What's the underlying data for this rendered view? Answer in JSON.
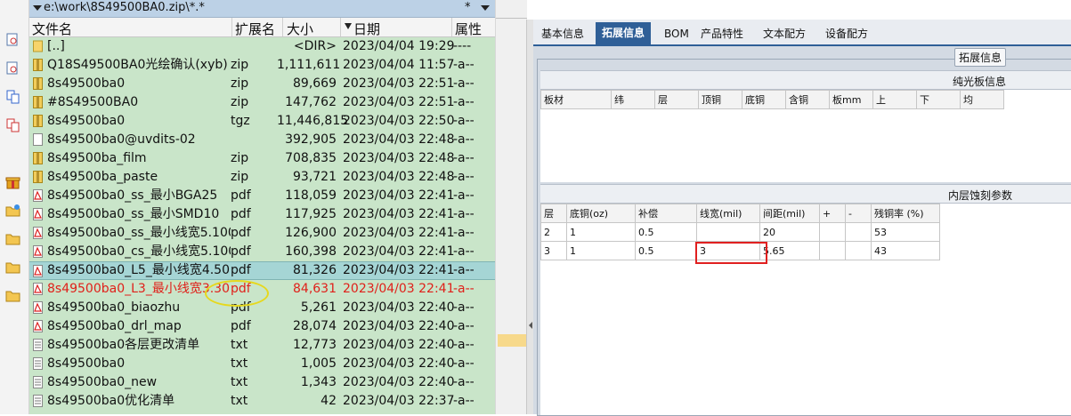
{
  "file_panel": {
    "path": "e:\\work\\8S49500BA0.zip\\*.*",
    "filter": "*",
    "columns": {
      "name": "文件名",
      "ext": "扩展名",
      "size": "大小",
      "date": "日期",
      "attr": "属性"
    },
    "files": [
      {
        "name": "[..]",
        "ext": "",
        "size": "<DIR>",
        "date": "2023/04/04 19:29",
        "attr": "----",
        "icon": "parent-folder-icon"
      },
      {
        "name": "Q18S49500BA0光绘确认(xyb)",
        "ext": "zip",
        "size": "1,111,611",
        "date": "2023/04/04 11:57",
        "attr": "-a--",
        "icon": "zip-icon"
      },
      {
        "name": "8s49500ba0",
        "ext": "zip",
        "size": "89,669",
        "date": "2023/04/03 22:51",
        "attr": "-a--",
        "icon": "zip-icon"
      },
      {
        "name": "#8S49500BA0",
        "ext": "zip",
        "size": "147,762",
        "date": "2023/04/03 22:51",
        "attr": "-a--",
        "icon": "zip-icon"
      },
      {
        "name": "8s49500ba0",
        "ext": "tgz",
        "size": "11,446,815",
        "date": "2023/04/03 22:50",
        "attr": "-a--",
        "icon": "zip-icon"
      },
      {
        "name": "8s49500ba0@uvdits-02",
        "ext": "",
        "size": "392,905",
        "date": "2023/04/03 22:48",
        "attr": "-a--",
        "icon": "file-icon"
      },
      {
        "name": "8s49500ba_film",
        "ext": "zip",
        "size": "708,835",
        "date": "2023/04/03 22:48",
        "attr": "-a--",
        "icon": "zip-icon"
      },
      {
        "name": "8s49500ba_paste",
        "ext": "zip",
        "size": "93,721",
        "date": "2023/04/03 22:48",
        "attr": "-a--",
        "icon": "zip-icon"
      },
      {
        "name": "8s49500ba0_ss_最小BGA25",
        "ext": "pdf",
        "size": "118,059",
        "date": "2023/04/03 22:41",
        "attr": "-a--",
        "icon": "pdf-icon"
      },
      {
        "name": "8s49500ba0_ss_最小SMD10",
        "ext": "pdf",
        "size": "117,925",
        "date": "2023/04/03 22:41",
        "attr": "-a--",
        "icon": "pdf-icon"
      },
      {
        "name": "8s49500ba0_ss_最小线宽5.100",
        "ext": "pdf",
        "size": "126,900",
        "date": "2023/04/03 22:41",
        "attr": "-a--",
        "icon": "pdf-icon"
      },
      {
        "name": "8s49500ba0_cs_最小线宽5.100",
        "ext": "pdf",
        "size": "160,398",
        "date": "2023/04/03 22:41",
        "attr": "-a--",
        "icon": "pdf-icon"
      },
      {
        "name": "8s49500ba0_L5_最小线宽4.50",
        "ext": "pdf",
        "size": "81,326",
        "date": "2023/04/03 22:41",
        "attr": "-a--",
        "icon": "pdf-icon",
        "selected": true
      },
      {
        "name": "8s49500ba0_L3_最小线宽3.30..",
        "ext": "pdf",
        "size": "84,631",
        "date": "2023/04/03 22:41",
        "attr": "-a--",
        "icon": "pdf-icon",
        "red": true
      },
      {
        "name": "8s49500ba0_biaozhu",
        "ext": "pdf",
        "size": "5,261",
        "date": "2023/04/03 22:40",
        "attr": "-a--",
        "icon": "pdf-icon"
      },
      {
        "name": "8s49500ba0_drl_map",
        "ext": "pdf",
        "size": "28,074",
        "date": "2023/04/03 22:40",
        "attr": "-a--",
        "icon": "pdf-icon"
      },
      {
        "name": "8s49500ba0各层更改清单",
        "ext": "txt",
        "size": "12,773",
        "date": "2023/04/03 22:40",
        "attr": "-a--",
        "icon": "txt-icon"
      },
      {
        "name": "8s49500ba0",
        "ext": "txt",
        "size": "1,005",
        "date": "2023/04/03 22:40",
        "attr": "-a--",
        "icon": "txt-icon"
      },
      {
        "name": "8s49500ba0_new",
        "ext": "txt",
        "size": "1,343",
        "date": "2023/04/03 22:40",
        "attr": "-a--",
        "icon": "txt-icon"
      },
      {
        "name": "8s49500ba0优化清单",
        "ext": "txt",
        "size": "42",
        "date": "2023/04/03 22:37",
        "attr": "-a--",
        "icon": "txt-icon"
      }
    ]
  },
  "tabs": [
    "基本信息",
    "拓展信息",
    "BOM",
    "产品特性",
    "文本配方",
    "设备配方"
  ],
  "active_tab": "拓展信息",
  "group_label": "拓展信息",
  "section1": {
    "title": "纯光板信息",
    "headers": [
      "板材",
      "纬",
      "层",
      "顶铜",
      "底铜",
      "含铜",
      "板mm",
      "上",
      "下",
      "均"
    ]
  },
  "section2": {
    "title": "内层蚀刻参数",
    "headers": [
      "层",
      "底铜(oz)",
      "补偿",
      "线宽(mil)",
      "间距(mil)",
      "+",
      "-",
      "残铜率 (%)"
    ],
    "rows": [
      [
        "2",
        "1",
        "0.5",
        "",
        "20",
        "",
        "",
        "53"
      ],
      [
        "3",
        "1",
        "0.5",
        "3",
        "5.65",
        "",
        "",
        "43"
      ]
    ]
  },
  "colors": {
    "file_bg": "#c9e5c9",
    "selected_row": "#a5d5d5",
    "tab_active": "#2f5f97",
    "highlight_red": "#e02020",
    "annotation_yellow": "#e6d81d"
  }
}
